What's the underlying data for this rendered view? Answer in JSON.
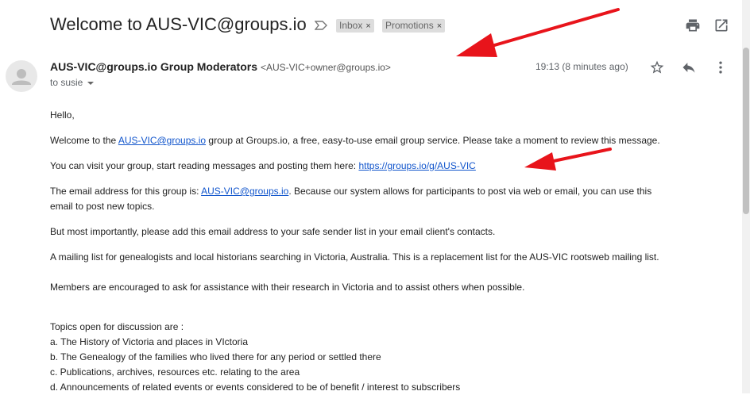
{
  "email": {
    "subject": "Welcome to AUS-VIC@groups.io",
    "labels": [
      "Inbox",
      "Promotions"
    ],
    "label_remove_glyph": "×",
    "sender_name": "AUS-VIC@groups.io Group Moderators",
    "sender_email": "<AUS-VIC+owner@groups.io>",
    "recipient": "to susie",
    "timestamp": "19:13 (8 minutes ago)"
  },
  "icons": {
    "importance": "importance-marker-icon",
    "print": "print-icon",
    "popout": "open-in-new-window-icon",
    "avatar": "default-user-avatar",
    "star": "star-icon",
    "reply": "reply-icon",
    "more": "more-vertical-icon"
  },
  "body": {
    "greeting": "Hello,",
    "p1_pre": "Welcome to the ",
    "p1_link": "AUS-VIC@groups.io",
    "p1_post": " group at Groups.io, a free, easy-to-use email group service. Please take a moment to review this message.",
    "p2_pre": "You can visit your group, start reading messages and posting them here: ",
    "p2_link": "https://groups.io/g/AUS-VIC",
    "p3_pre": "The email address for this group is: ",
    "p3_link": "AUS-VIC@groups.io",
    "p3_post": ". Because our system allows for participants to post via web or email, you can use this",
    "p3_line2": "email to post new topics.",
    "p4": "But most importantly, please add this email address to your safe sender list in your email client's contacts.",
    "p5": "A mailing list for genealogists and local historians searching in Victoria, Australia. This is a replacement list for the AUS-VIC rootsweb mailing list.",
    "p6": "Members are encouraged to ask for assistance with their research in Victoria and to assist others when possible.",
    "topics_heading": "Topics open for discussion are :",
    "topics": [
      "a. The History of Victoria and places in VIctoria",
      "b. The Genealogy of the families who lived there for any period or settled there",
      "c. Publications, archives, resources etc. relating to the area",
      "d. Announcements of related events or events considered to be of benefit / interest to subscribers"
    ]
  },
  "colors": {
    "link": "#1155cc",
    "annotation_arrow": "#e8141b",
    "label_chip": "#dddddd"
  }
}
